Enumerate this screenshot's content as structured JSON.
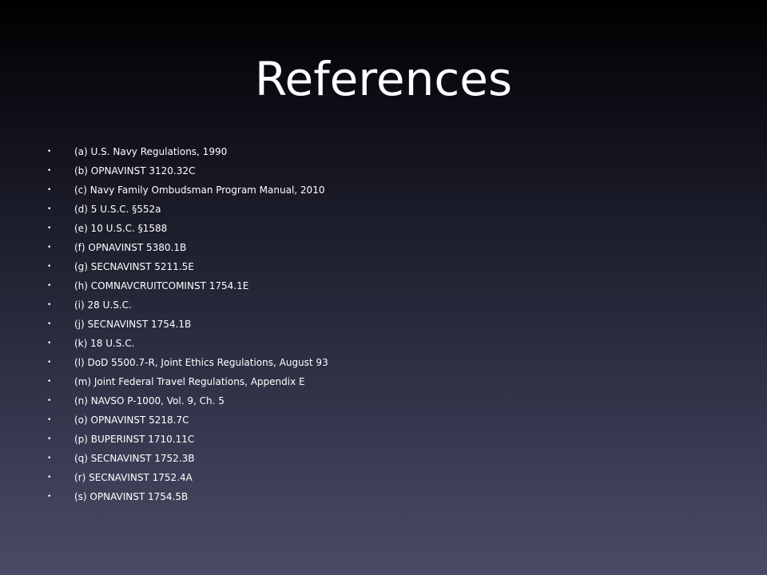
{
  "slide": {
    "title": "References",
    "bullet_glyph": "•",
    "references": [
      "(a) U.S. Navy Regulations, 1990",
      "(b) OPNAVINST 3120.32C",
      "(c) Navy Family Ombudsman Program Manual, 2010",
      "(d) 5 U.S.C. §552a",
      "(e) 10 U.S.C. §1588",
      "(f) OPNAVINST 5380.1B",
      "(g) SECNAVINST 5211.5E",
      "(h) COMNAVCRUITCOMINST 1754.1E",
      "(i) 28 U.S.C.",
      "(j) SECNAVINST 1754.1B",
      "(k) 18 U.S.C.",
      "(l) DoD 5500.7-R, Joint Ethics Regulations, August 93",
      "(m) Joint Federal Travel Regulations, Appendix E",
      "(n) NAVSO P-1000, Vol. 9, Ch. 5",
      "(o) OPNAVINST 5218.7C",
      "(p) BUPERINST 1710.11C",
      "(q) SECNAVINST 1752.3B",
      "(r) SECNAVINST 1752.4A",
      "(s) OPNAVINST 1754.5B"
    ]
  },
  "colors": {
    "text": "#ffffff",
    "background_top": "#000000",
    "background_bottom": "#4a4c66"
  }
}
